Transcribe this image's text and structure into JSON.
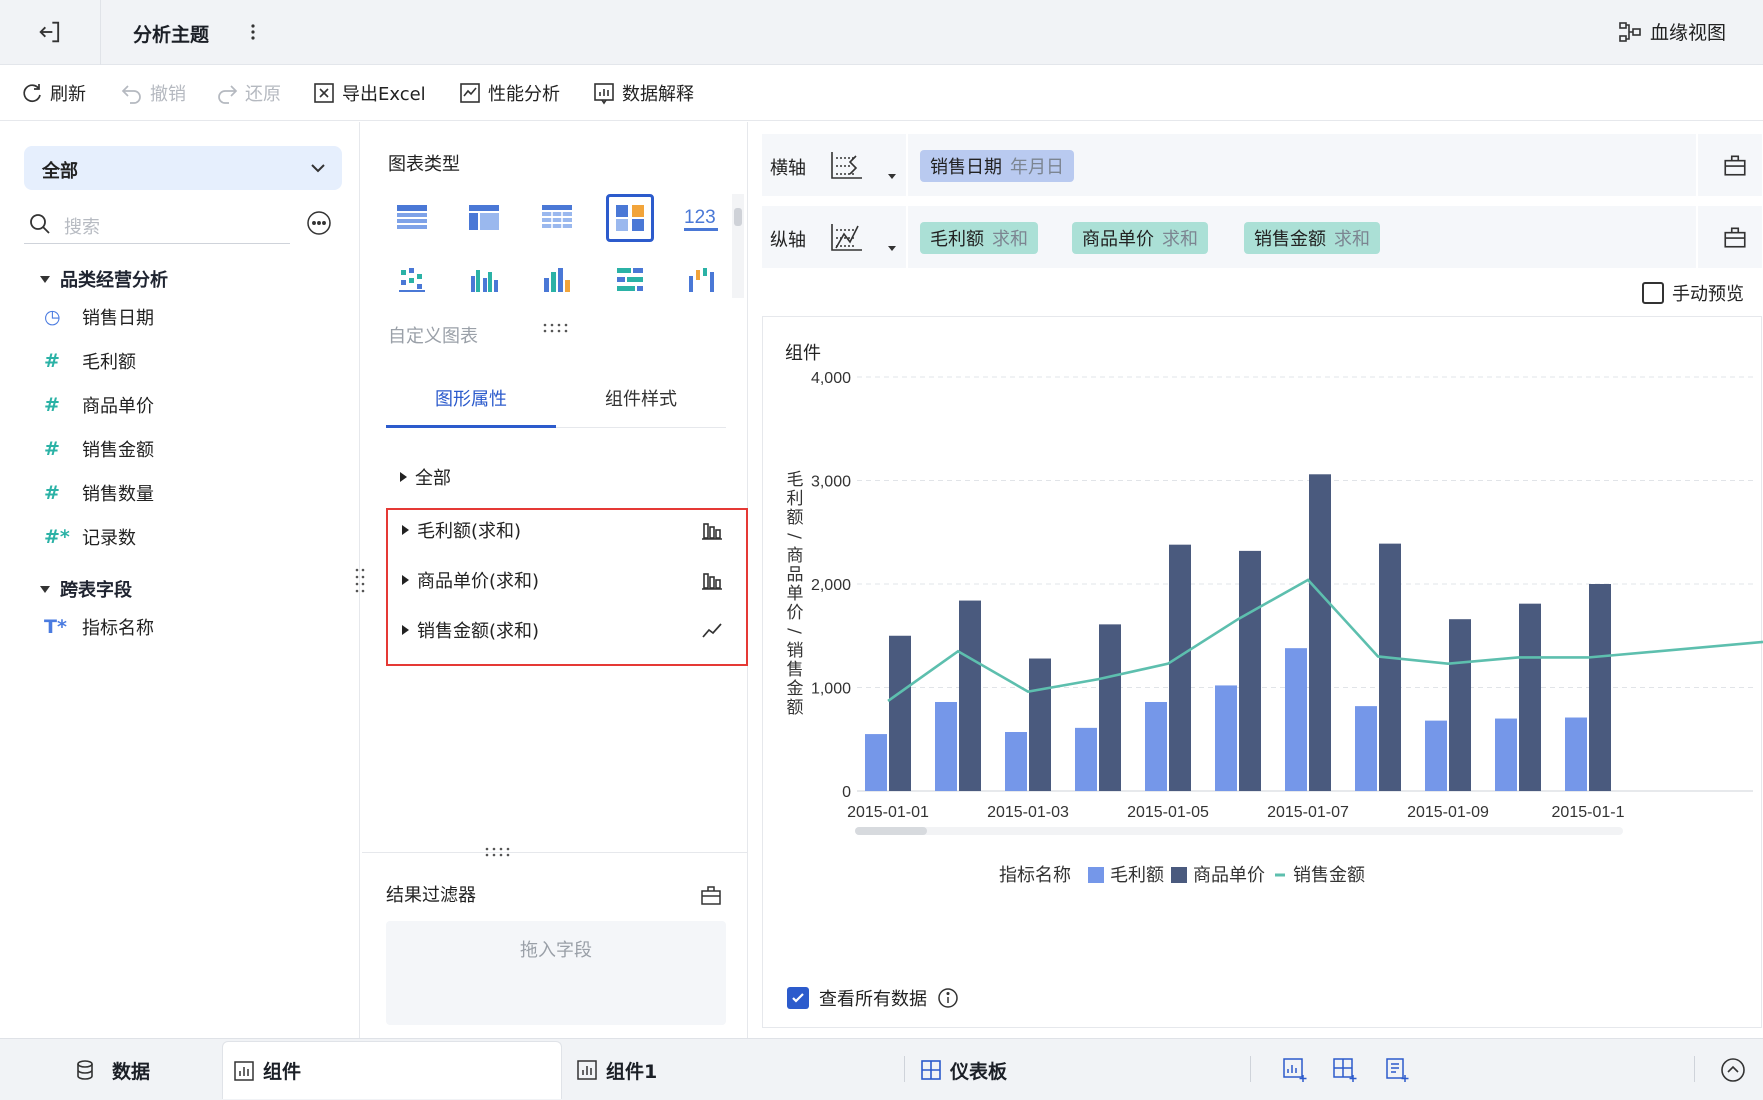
{
  "topbar": {
    "title": "分析主题",
    "lineage_label": "血缘视图"
  },
  "toolbar": {
    "refresh": "刷新",
    "undo": "撤销",
    "redo": "还原",
    "export_excel": "导出Excel",
    "perf": "性能分析",
    "explain": "数据解释"
  },
  "left": {
    "scope": "全部",
    "search_placeholder": "搜索",
    "groups": [
      {
        "name": "品类经营分析"
      },
      {
        "name": "跨表字段"
      }
    ],
    "fields": [
      {
        "icon": "clock-icon",
        "glyph": "◷",
        "label": "销售日期"
      },
      {
        "icon": "hash-icon",
        "glyph": "#",
        "label": "毛利额"
      },
      {
        "icon": "hash-icon",
        "glyph": "#",
        "label": "商品单价"
      },
      {
        "icon": "hash-icon",
        "glyph": "#",
        "label": "销售金额"
      },
      {
        "icon": "hash-icon",
        "glyph": "#",
        "label": "销售数量"
      },
      {
        "icon": "hash-star-icon",
        "glyph": "#*",
        "label": "记录数"
      },
      {
        "icon": "text-star-icon",
        "glyph": "T*",
        "label": "指标名称"
      }
    ]
  },
  "mid": {
    "chart_type_title": "图表类型",
    "custom_chart": "自定义图表",
    "tab_graphic": "图形属性",
    "tab_style": "组件样式",
    "prop_all": "全部",
    "props": [
      {
        "label": "毛利额(求和)",
        "icon": "bar-chart-icon"
      },
      {
        "label": "商品单价(求和)",
        "icon": "bar-chart-icon"
      },
      {
        "label": "销售金额(求和)",
        "icon": "line-chart-icon"
      }
    ],
    "filter_title": "结果过滤器",
    "dropzone": "拖入字段"
  },
  "right": {
    "x_axis_label": "横轴",
    "y_axis_label": "纵轴",
    "x_pill": {
      "name": "销售日期",
      "agg": "年月日"
    },
    "y_pills": [
      {
        "name": "毛利额",
        "agg": "求和"
      },
      {
        "name": "商品单价",
        "agg": "求和"
      },
      {
        "name": "销售金额",
        "agg": "求和"
      }
    ],
    "manual_preview": "手动预览",
    "card_title": "组件",
    "view_all": "查看所有数据"
  },
  "chart_data": {
    "type": "bar",
    "title": "组件",
    "ylabel": "毛利额/商品单价/销售金额",
    "ylim": [
      0,
      4000
    ],
    "yticks": [
      "4,000",
      "3,000",
      "2,000",
      "1,000",
      "0"
    ],
    "ytick_values": [
      4000,
      3000,
      2000,
      1000,
      0
    ],
    "categories": [
      "2015-01-01",
      "2015-01-02",
      "2015-01-03",
      "2015-01-04",
      "2015-01-05",
      "2015-01-06",
      "2015-01-07",
      "2015-01-08",
      "2015-01-09",
      "2015-01-10",
      "2015-01-11"
    ],
    "xtick_labels": [
      "2015-01-01",
      "2015-01-03",
      "2015-01-05",
      "2015-01-07",
      "2015-01-09",
      "2015-01-1"
    ],
    "legend_title": "指标名称",
    "series": [
      {
        "name": "毛利额",
        "kind": "bar",
        "color": "#7597e9",
        "values": [
          550,
          860,
          570,
          610,
          860,
          1020,
          1380,
          820,
          680,
          700,
          710
        ]
      },
      {
        "name": "商品单价",
        "kind": "bar",
        "color": "#4a5a7e",
        "values": [
          1500,
          1840,
          1280,
          1610,
          2380,
          2320,
          3060,
          2390,
          1660,
          1810,
          2000
        ]
      },
      {
        "name": "销售金额",
        "kind": "line",
        "color": "#5dbfae",
        "values": [
          870,
          1350,
          960,
          1080,
          1230,
          1660,
          2040,
          1300,
          1230,
          1290,
          1290
        ]
      }
    ],
    "line_tail_value": 1440,
    "grid": true,
    "legend_position": "bottom"
  },
  "bottom": {
    "data": "数据",
    "comp": "组件",
    "comp1": "组件1",
    "dashboard": "仪表板"
  }
}
